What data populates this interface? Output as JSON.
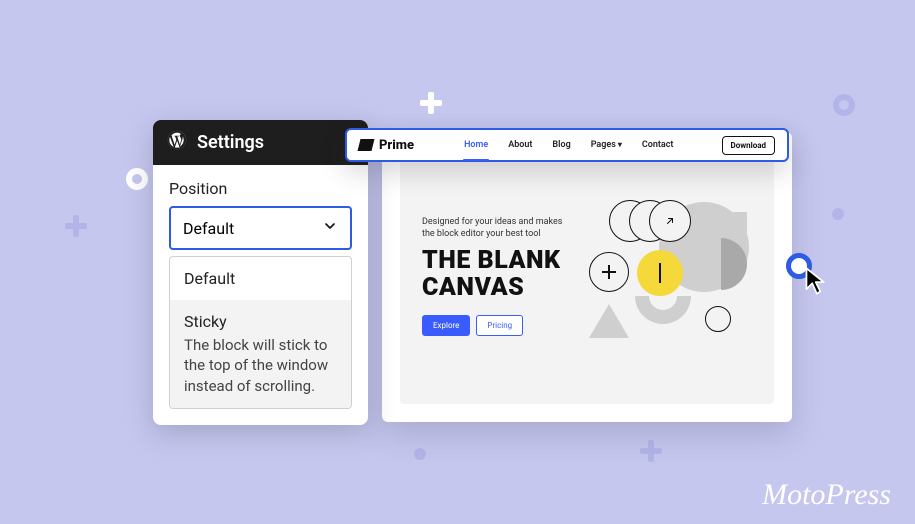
{
  "settings": {
    "title": "Settings",
    "field_label": "Position",
    "selected": "Default",
    "options": {
      "default": {
        "name": "Default"
      },
      "sticky": {
        "name": "Sticky",
        "desc": "The block will stick to the top of the window instead of scrolling."
      }
    }
  },
  "navbar": {
    "brand": "Prime",
    "links": [
      "Home",
      "About",
      "Blog",
      "Pages",
      "Contact"
    ],
    "active_index": 0,
    "cta": "Download"
  },
  "hero": {
    "subtitle_line1": "Designed for your ideas and makes",
    "subtitle_line2": "the block editor your best tool",
    "title_line1": "THE BLANK",
    "title_line2": "CANVAS",
    "buttons": {
      "primary": "Explore",
      "secondary": "Pricing"
    }
  },
  "signature": "MotoPress",
  "colors": {
    "canvas_bg": "#c6c7ef",
    "accent": "#2d5be3",
    "yellow": "#f5d93a"
  }
}
